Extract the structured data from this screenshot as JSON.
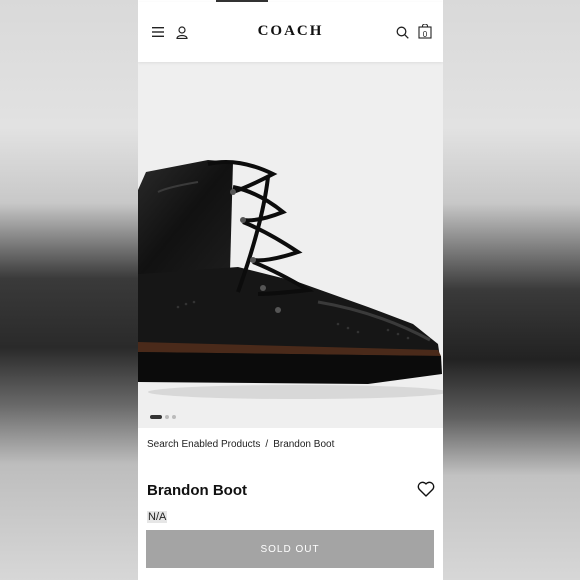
{
  "header": {
    "brand": "COACH",
    "cart_count": "0"
  },
  "carousel": {
    "slide_count": 3,
    "active_index": 0
  },
  "breadcrumb": {
    "items": [
      "Search Enabled Products",
      "Brandon Boot"
    ],
    "separator": "/"
  },
  "product": {
    "name": "Brandon Boot",
    "price": "N/A",
    "button_label": "SOLD OUT"
  },
  "colors": {
    "button_bg": "#a4a4a4",
    "boot": "#151515"
  },
  "icons": [
    "menu-icon",
    "user-icon",
    "search-icon",
    "bag-icon",
    "heart-icon"
  ]
}
